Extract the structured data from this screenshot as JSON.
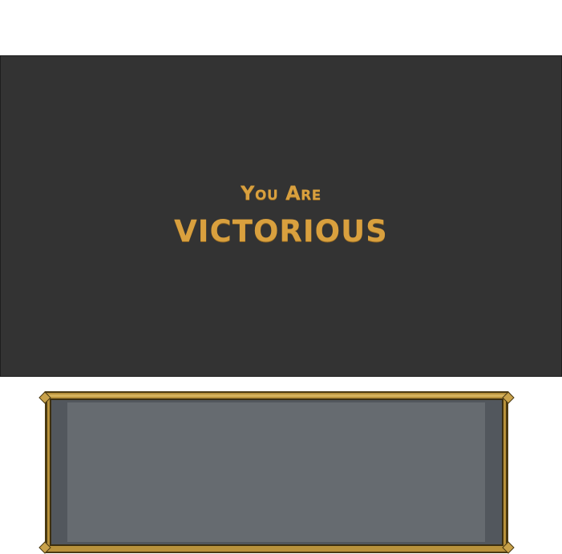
{
  "victory": {
    "line_1": "You Are",
    "line_2": "VICTORIOUS"
  },
  "colors": {
    "screen_background": "#333333",
    "title_gold": "#d9a03e",
    "frame_gold": "#b8923c",
    "frame_dark": "#4b3a12",
    "panel_slate": "#52575d",
    "panel_fill": "#666b70"
  }
}
